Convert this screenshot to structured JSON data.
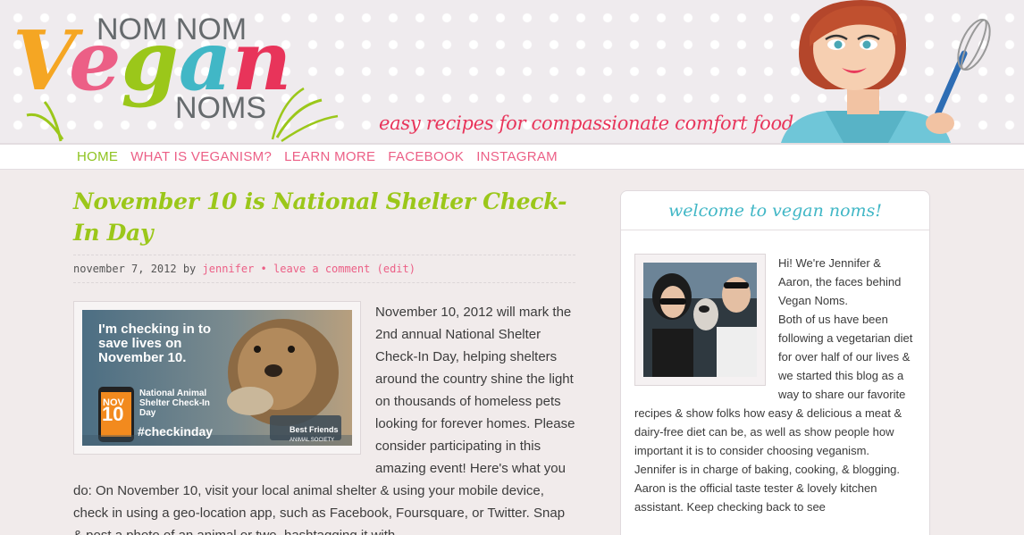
{
  "header": {
    "logo": {
      "top": "NOM NOM",
      "main": "Vegan",
      "bottom": "NOMS"
    },
    "tagline": "easy recipes for compassionate comfort food"
  },
  "nav": {
    "items": [
      "HOME",
      "WHAT IS VEGANISM?",
      "LEARN MORE",
      "FACEBOOK",
      "INSTAGRAM"
    ]
  },
  "post": {
    "title": "November 10 is National Shelter Check-In Day",
    "meta": {
      "date": "november 7, 2012",
      "by": "by",
      "author": "jennifer",
      "separator": "•",
      "comment": "leave a comment",
      "edit": "(edit)"
    },
    "image": {
      "headline": "I'm checking in to save lives on November 10.",
      "calendar_month": "NOV",
      "calendar_day": "10",
      "subtitle": "National Animal Shelter Check-In Day",
      "hashtag": "#checkinday",
      "brand": "Best Friends",
      "brand_sub": "ANIMAL SOCIETY"
    },
    "body": "November 10, 2012 will mark the 2nd annual National Shelter Check-In Day, helping shelters around the country shine the light on thousands of homeless pets looking for forever homes. Please consider participating in this amazing event! Here's what you do: On November 10, visit your local animal shelter & using your mobile device, check in using a geo-location app, such as Facebook, Foursquare, or Twitter. Snap & post a photo of an animal or two, hashtagging it with"
  },
  "sidebar": {
    "title": "welcome to vegan noms!",
    "paragraphs": [
      "Hi! We're Jennifer & Aaron, the faces behind Vegan Noms.",
      "Both of us have been following a vegetarian diet for over half of our lives & we started this blog as a way to share our favorite recipes & show folks how easy & delicious a meat & dairy-free diet can be, as well as show people how important it is to consider choosing veganism.",
      "Jennifer is in charge of baking, cooking, & blogging. Aaron is the official taste tester & lovely kitchen assistant. Keep checking back to see"
    ]
  },
  "colors": {
    "green": "#9bc71a",
    "pink": "#ec5f86",
    "teal": "#41b7c6",
    "tagline_red": "#e8345a"
  }
}
